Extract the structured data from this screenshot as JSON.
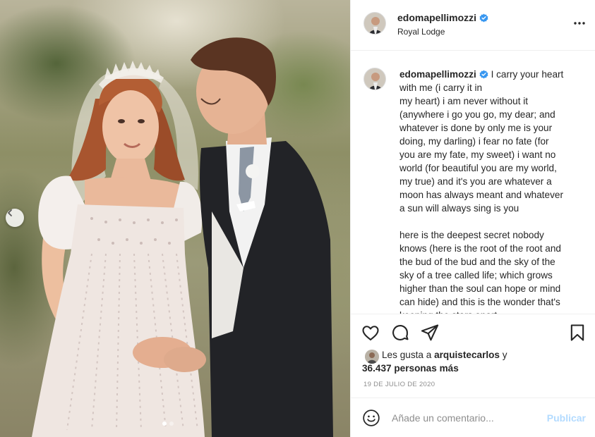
{
  "post": {
    "username": "edomapellimozzi",
    "verified": true,
    "location": "Royal Lodge"
  },
  "caption": {
    "username": "edomapellimozzi",
    "text": "I carry your heart\nwith me (i carry it in\nmy heart) i am never without it\n(anywhere i go you go, my dear; and\nwhatever is done by only me is your\ndoing, my darling) i fear no fate (for\nyou are my fate, my sweet) i want no\nworld (for beautiful you are my world,\nmy true) and it's you are whatever a\nmoon has always meant and whatever\na sun will always sing is you\n\nhere is the deepest secret nobody\nknows (here is the root of the root and\nthe bud of the bud and the sky of the\nsky of a tree called life; which grows\nhigher than the soul can hope or mind\ncan hide) and this is the wonder that's\nkeeping the stars apart"
  },
  "likes": {
    "prefix": "Les gusta a ",
    "user": "arquistecarlos",
    "suffix": " y",
    "count_line": "36.437 personas más"
  },
  "date": "19 de julio de 2020",
  "comment": {
    "placeholder": "Añade un comentario...",
    "publish_label": "Publicar"
  },
  "colors": {
    "verified": "#3897f0",
    "publish_disabled": "#b3dbff",
    "muted": "#8e8e8e",
    "text": "#262626"
  },
  "icons": {
    "more": "more-icon",
    "like": "heart-icon",
    "comment": "comment-icon",
    "share": "share-icon",
    "save": "bookmark-icon",
    "emoji": "emoji-icon",
    "carousel_prev": "chevron-left-icon"
  },
  "carousel": {
    "slides": 2,
    "active": 1
  }
}
